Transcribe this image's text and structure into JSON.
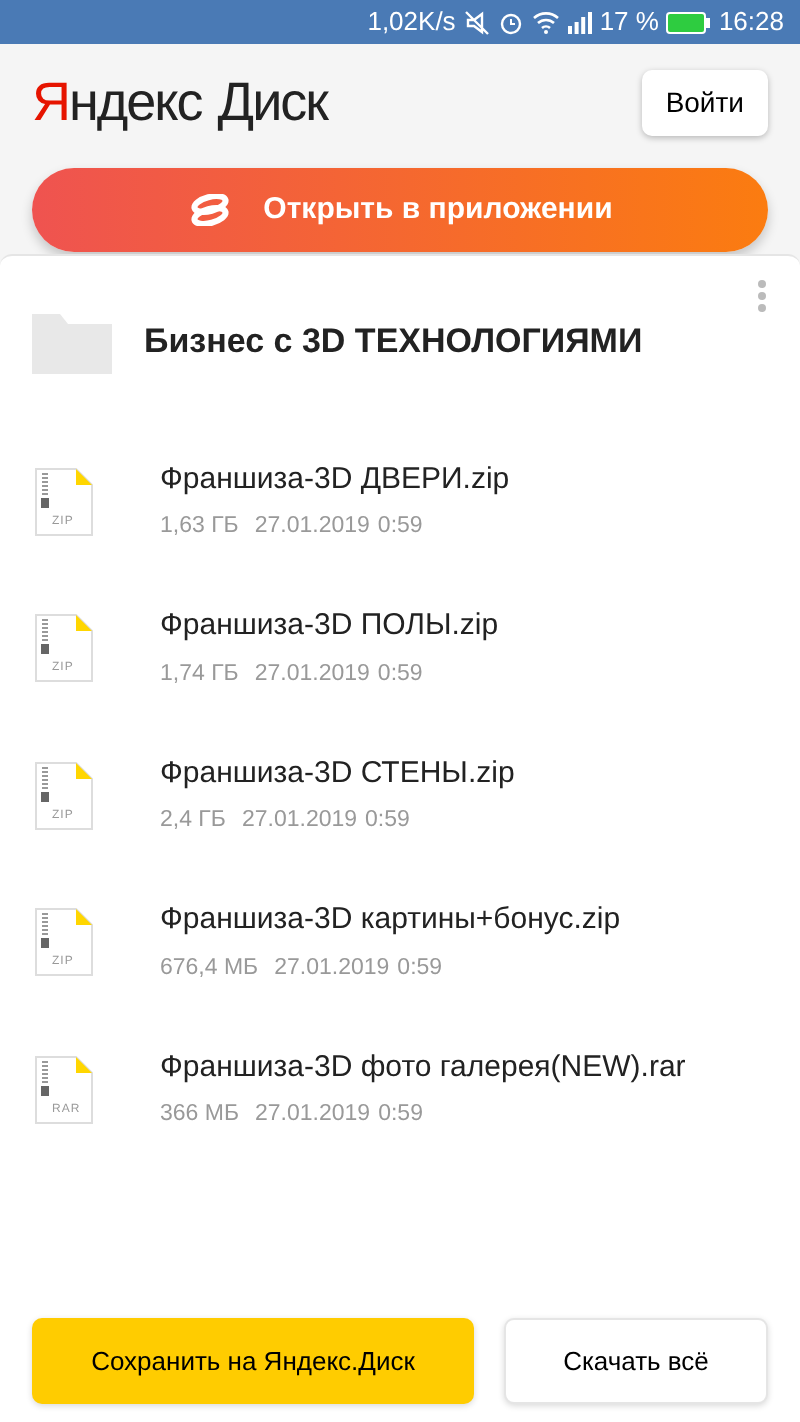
{
  "status_bar": {
    "speed": "1,02K/s",
    "battery": "17 %",
    "time": "16:28"
  },
  "header": {
    "logo_brand": "Яндекс",
    "logo_product": "Диск",
    "login_button": "Войти"
  },
  "open_app_button": "Открыть в приложении",
  "folder": {
    "title": "Бизнес с 3D ТЕХНОЛОГИЯМИ"
  },
  "files": [
    {
      "name": "Франшиза-3D ДВЕРИ.zip",
      "type_label": "ZIP",
      "size": "1,63 ГБ",
      "date": "27.01.2019",
      "time": "0:59"
    },
    {
      "name": "Франшиза-3D ПОЛЫ.zip",
      "type_label": "ZIP",
      "size": "1,74 ГБ",
      "date": "27.01.2019",
      "time": "0:59"
    },
    {
      "name": "Франшиза-3D СТЕНЫ.zip",
      "type_label": "ZIP",
      "size": "2,4 ГБ",
      "date": "27.01.2019",
      "time": "0:59"
    },
    {
      "name": "Франшиза-3D картины+бонус.zip",
      "type_label": "ZIP",
      "size": "676,4 МБ",
      "date": "27.01.2019",
      "time": "0:59"
    },
    {
      "name": "Франшиза-3D фото галерея(NEW).rar",
      "type_label": "RAR",
      "size": "366 МБ",
      "date": "27.01.2019",
      "time": "0:59"
    }
  ],
  "footer": {
    "save_button": "Сохранить на Яндекс.Диск",
    "download_button": "Скачать всё"
  }
}
